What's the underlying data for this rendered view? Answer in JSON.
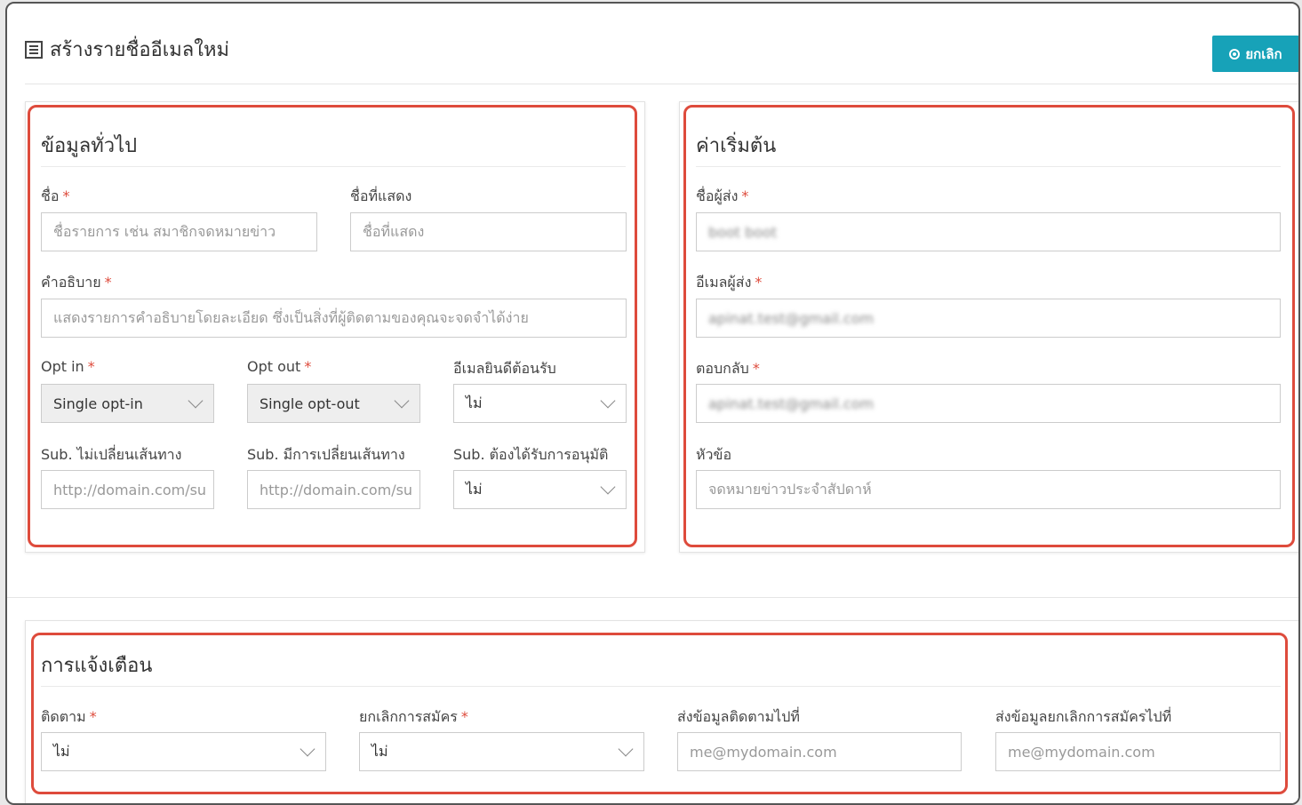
{
  "page": {
    "title": "สร้างรายชื่ออีเมลใหม่",
    "cancel_label": "ยกเลิก"
  },
  "general": {
    "title": "ข้อมูลทั่วไป",
    "name_label": "ชื่อ",
    "name_placeholder": "ชื่อรายการ เช่น สมาชิกจดหมายข่าว",
    "display_label": "ชื่อที่แสดง",
    "display_placeholder": "ชื่อที่แสดง",
    "desc_label": "คำอธิบาย",
    "desc_placeholder": "แสดงรายการคำอธิบายโดยละเอียด ซึ่งเป็นสิ่งที่ผู้ติดตามของคุณจะจดจำได้ง่าย",
    "optin_label": "Opt in",
    "optin_value": "Single opt-in",
    "optout_label": "Opt out",
    "optout_value": "Single opt-out",
    "welcome_label": "อีเมลยินดีต้อนรับ",
    "welcome_value": "ไม่",
    "sub_noredirect_label": "Sub. ไม่เปลี่ยนเส้นทาง",
    "sub_noredirect_placeholder": "http://domain.com/su",
    "sub_redirect_label": "Sub. มีการเปลี่ยนเส้นทาง",
    "sub_redirect_placeholder": "http://domain.com/su",
    "sub_approval_label": "Sub. ต้องได้รับการอนุมัติ",
    "sub_approval_value": "ไม่"
  },
  "defaults": {
    "title": "ค่าเริ่มต้น",
    "sender_name_label": "ชื่อผู้ส่ง",
    "sender_name_value": "boot boot",
    "sender_email_label": "อีเมลผู้ส่ง",
    "sender_email_value": "apinat.test@gmail.com",
    "reply_label": "ตอบกลับ",
    "reply_value": "apinat.test@gmail.com",
    "subject_label": "หัวข้อ",
    "subject_placeholder": "จดหมายข่าวประจำสัปดาห์"
  },
  "notify": {
    "title": "การแจ้งเตือน",
    "follow_label": "ติดตาม",
    "follow_value": "ไม่",
    "unsub_label": "ยกเลิกการสมัคร",
    "unsub_value": "ไม่",
    "send_follow_label": "ส่งข้อมูลติดตามไปที่",
    "send_follow_placeholder": "me@mydomain.com",
    "send_unsub_label": "ส่งข้อมูลยกเลิกการสมัครไปที่",
    "send_unsub_placeholder": "me@mydomain.com"
  },
  "colors": {
    "accent": "#17a2b8",
    "highlight": "#de4b3c",
    "required": "#de4b3c"
  }
}
